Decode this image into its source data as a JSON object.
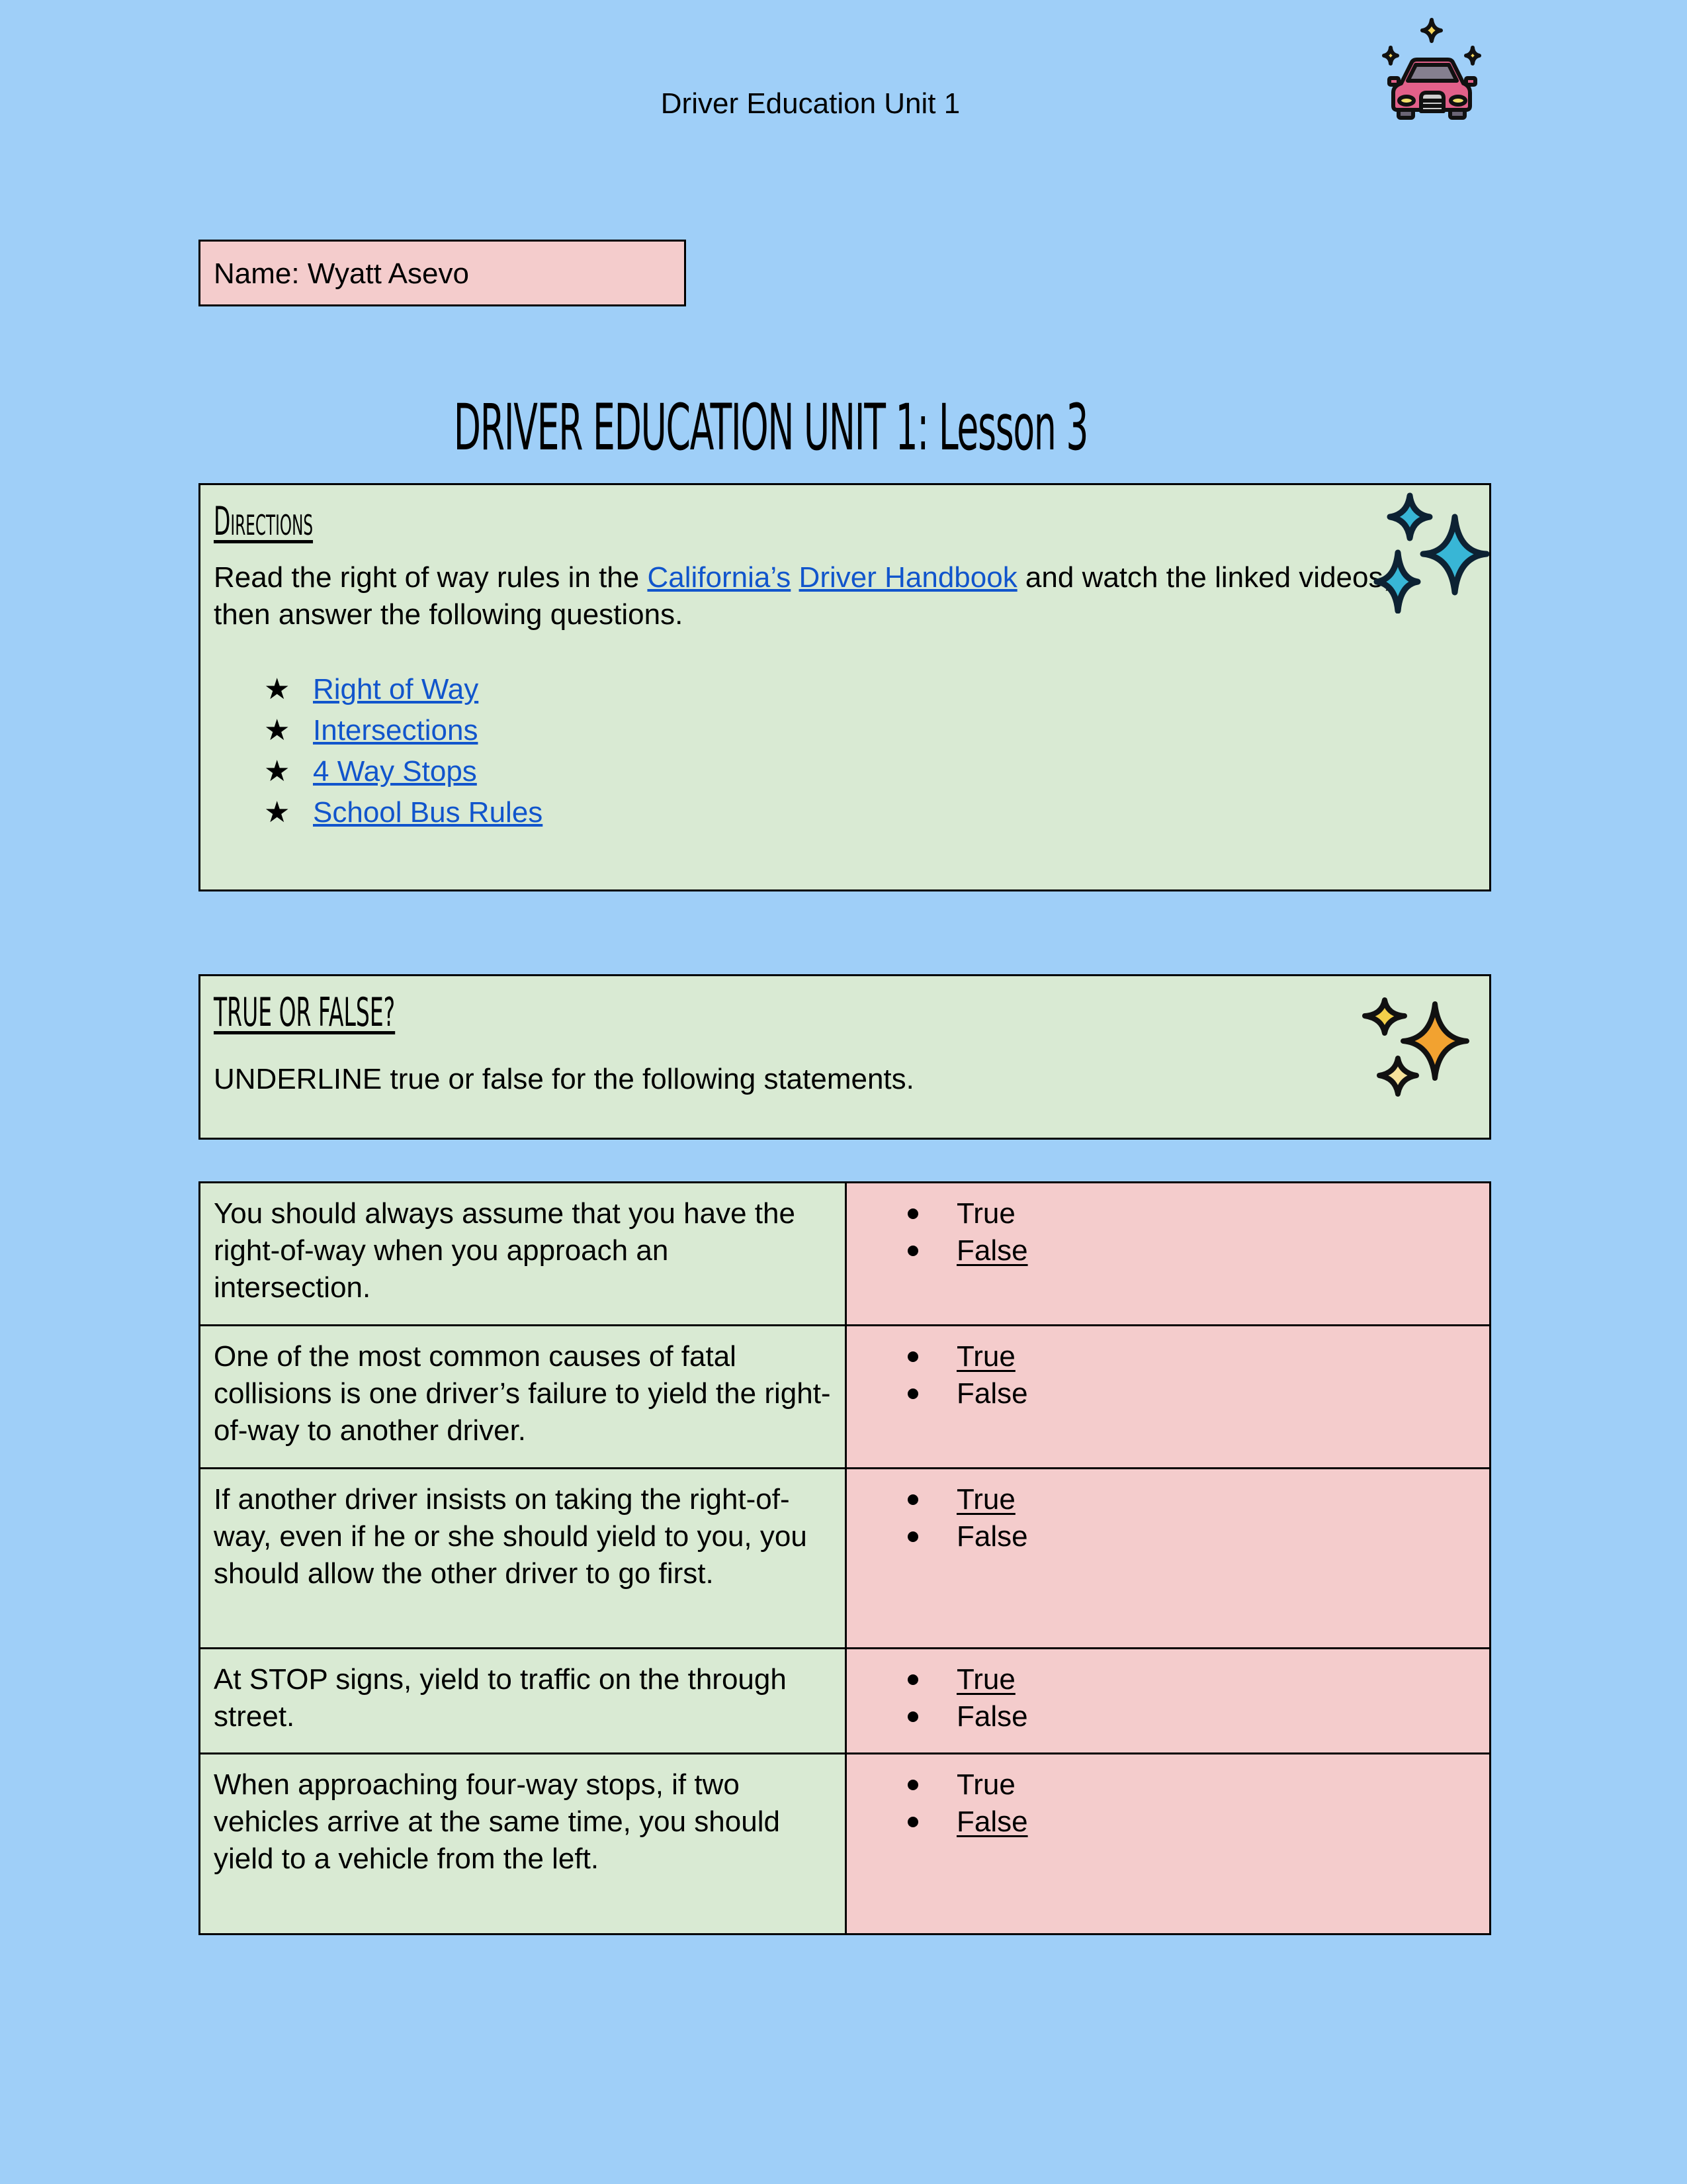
{
  "header": {
    "title": "Driver Education Unit 1",
    "icon": "car-sparkle-icon"
  },
  "name_field": {
    "label": "Name:",
    "value": "Wyatt Asevo",
    "text": "Name: Wyatt Asevo"
  },
  "lesson_title": "DRIVER EDUCATION UNIT 1: Lesson 3",
  "directions": {
    "heading": "Directions",
    "text_before": "Read the right of way rules in the ",
    "link1": "California’s",
    "link2": "Driver Handbook",
    "text_after": " and watch the linked videos, then answer the following questions.",
    "icon": "blue-sparkles-icon",
    "links": [
      {
        "label": "Right of Way"
      },
      {
        "label": "Intersections"
      },
      {
        "label": "4 Way Stops"
      },
      {
        "label": "School Bus Rules"
      }
    ],
    "bullet": "★"
  },
  "true_false": {
    "heading": "TRUE OR FALSE?",
    "instruction": "UNDERLINE true or false for the following statements.",
    "icon": "orange-sparkles-icon"
  },
  "questions": [
    {
      "statement": "You should always assume that you have the right-of-way when you approach an intersection.",
      "options": [
        "True",
        "False"
      ],
      "underlined": "False"
    },
    {
      "statement": "One of the most common causes of fatal collisions is one driver’s failure to yield the right-of-way to another driver.",
      "options": [
        "True",
        "False"
      ],
      "underlined": "True"
    },
    {
      "statement": "If another driver insists on taking the right-of-way, even if he or she should yield to you, you should allow the other driver to go first.",
      "options": [
        "True",
        "False"
      ],
      "underlined": "True"
    },
    {
      "statement": "At STOP signs, yield to traffic on the through street.",
      "options": [
        "True",
        "False"
      ],
      "underlined": "True"
    },
    {
      "statement": "When approaching four-way stops, if two vehicles arrive at the same time, you should yield to a vehicle from the left.",
      "options": [
        "True",
        "False"
      ],
      "underlined": "False"
    }
  ],
  "colors": {
    "page_bg": "#9fcff8",
    "green_box": "#d9ead3",
    "pink_box": "#f4cccc",
    "link": "#1155cc"
  }
}
